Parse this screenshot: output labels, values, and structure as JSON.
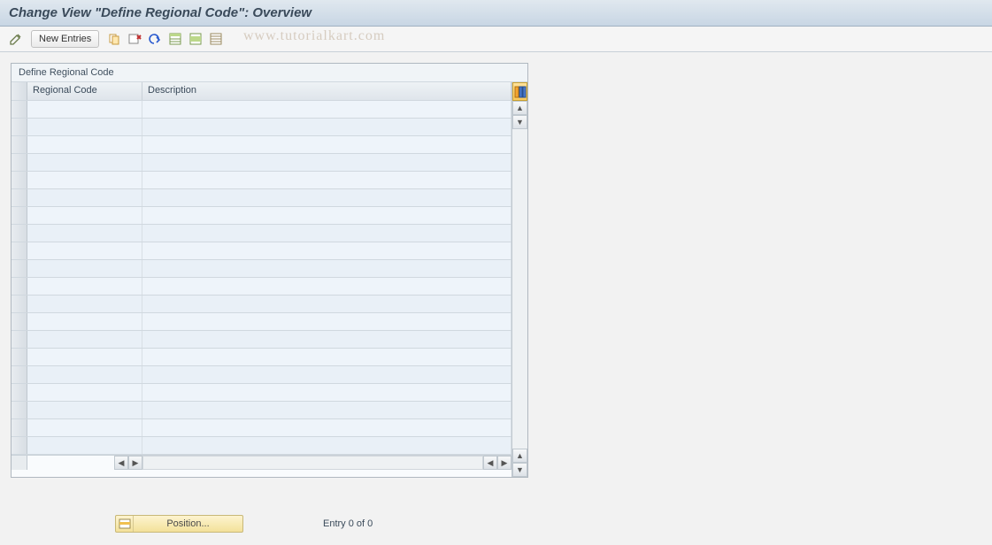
{
  "title": "Change View \"Define Regional Code\": Overview",
  "toolbar": {
    "new_entries": "New Entries"
  },
  "watermark": "www.tutorialkart.com",
  "table": {
    "title": "Define Regional Code",
    "columns": {
      "regional_code": "Regional Code",
      "description": "Description"
    },
    "rows": [
      {
        "code": "",
        "desc": ""
      },
      {
        "code": "",
        "desc": ""
      },
      {
        "code": "",
        "desc": ""
      },
      {
        "code": "",
        "desc": ""
      },
      {
        "code": "",
        "desc": ""
      },
      {
        "code": "",
        "desc": ""
      },
      {
        "code": "",
        "desc": ""
      },
      {
        "code": "",
        "desc": ""
      },
      {
        "code": "",
        "desc": ""
      },
      {
        "code": "",
        "desc": ""
      },
      {
        "code": "",
        "desc": ""
      },
      {
        "code": "",
        "desc": ""
      },
      {
        "code": "",
        "desc": ""
      },
      {
        "code": "",
        "desc": ""
      },
      {
        "code": "",
        "desc": ""
      },
      {
        "code": "",
        "desc": ""
      },
      {
        "code": "",
        "desc": ""
      },
      {
        "code": "",
        "desc": ""
      },
      {
        "code": "",
        "desc": ""
      },
      {
        "code": "",
        "desc": ""
      }
    ]
  },
  "footer": {
    "position_label": "Position...",
    "entry_status": "Entry 0 of 0"
  },
  "icons": {
    "display_change": "display-change-icon",
    "copy": "copy-icon",
    "delete": "delete-icon",
    "undo": "undo-icon",
    "select_all": "select-all-icon",
    "select_block": "select-block-icon",
    "deselect_all": "deselect-all-icon",
    "config": "config-columns-icon",
    "position": "position-icon"
  }
}
